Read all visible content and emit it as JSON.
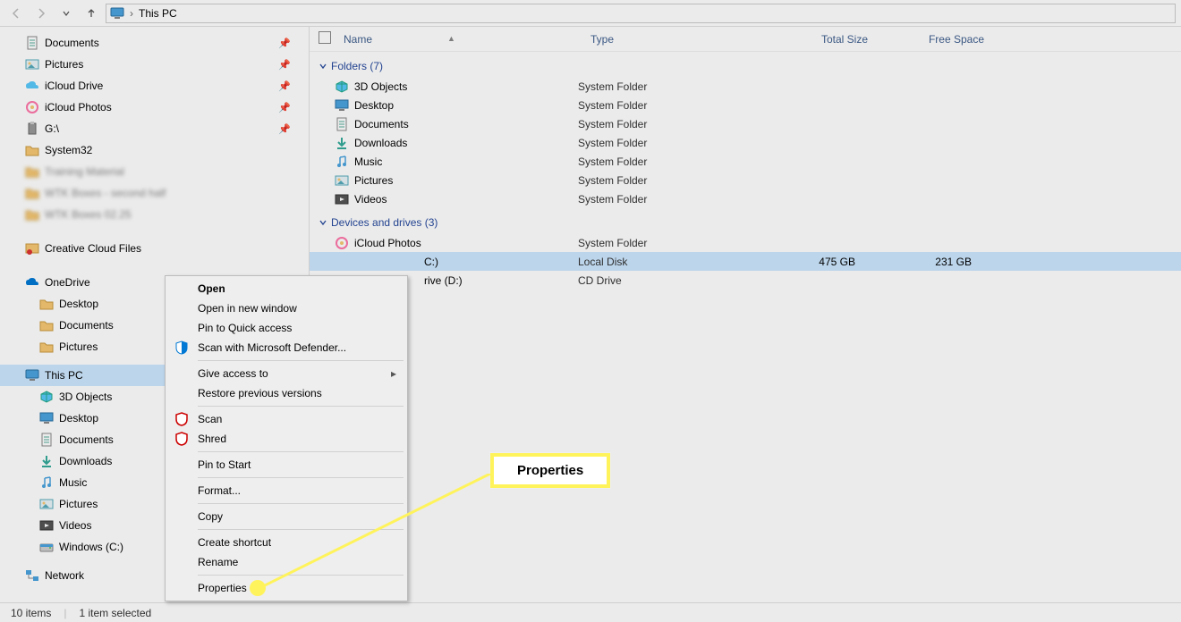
{
  "address": {
    "location": "This PC"
  },
  "sidebar": {
    "quick": [
      {
        "label": "Documents",
        "icon": "doc",
        "pinned": true
      },
      {
        "label": "Pictures",
        "icon": "pic",
        "pinned": true
      },
      {
        "label": "iCloud Drive",
        "icon": "icloud",
        "pinned": true
      },
      {
        "label": "iCloud Photos",
        "icon": "iphotos",
        "pinned": true
      },
      {
        "label": "G:\\",
        "icon": "usb",
        "pinned": true
      },
      {
        "label": "System32",
        "icon": "folder",
        "pinned": false
      },
      {
        "label": "Training Material",
        "icon": "folder",
        "pinned": false,
        "blurred": true
      },
      {
        "label": "WTK Boxes - second half",
        "icon": "folder",
        "pinned": false,
        "blurred": true
      },
      {
        "label": "WTK Boxes 02.25",
        "icon": "folder",
        "pinned": false,
        "blurred": true
      }
    ],
    "creative_label": "Creative Cloud Files",
    "onedrive": {
      "label": "OneDrive",
      "items": [
        {
          "label": "Desktop"
        },
        {
          "label": "Documents"
        },
        {
          "label": "Pictures"
        }
      ]
    },
    "thispc": {
      "label": "This PC",
      "items": [
        {
          "label": "3D Objects",
          "icon": "3d"
        },
        {
          "label": "Desktop",
          "icon": "desktop"
        },
        {
          "label": "Documents",
          "icon": "doc"
        },
        {
          "label": "Downloads",
          "icon": "down"
        },
        {
          "label": "Music",
          "icon": "music"
        },
        {
          "label": "Pictures",
          "icon": "pic"
        },
        {
          "label": "Videos",
          "icon": "video"
        },
        {
          "label": "Windows (C:)",
          "icon": "drive"
        }
      ]
    },
    "network_label": "Network"
  },
  "columns": {
    "name": "Name",
    "type": "Type",
    "total": "Total Size",
    "free": "Free Space"
  },
  "groups": {
    "folders": {
      "header": "Folders (7)",
      "items": [
        {
          "name": "3D Objects",
          "type": "System Folder",
          "icon": "3d"
        },
        {
          "name": "Desktop",
          "type": "System Folder",
          "icon": "desktop"
        },
        {
          "name": "Documents",
          "type": "System Folder",
          "icon": "doc"
        },
        {
          "name": "Downloads",
          "type": "System Folder",
          "icon": "down"
        },
        {
          "name": "Music",
          "type": "System Folder",
          "icon": "music"
        },
        {
          "name": "Pictures",
          "type": "System Folder",
          "icon": "pic"
        },
        {
          "name": "Videos",
          "type": "System Folder",
          "icon": "video"
        }
      ]
    },
    "drives": {
      "header": "Devices and drives (3)",
      "items": [
        {
          "name": "iCloud Photos",
          "type": "System Folder",
          "icon": "iphotos"
        },
        {
          "name": "Windows (C:)",
          "type": "Local Disk",
          "total": "475 GB",
          "free": "231 GB",
          "icon": "drive",
          "selected": true,
          "clipped": "C:)"
        },
        {
          "name": "DVD RW Drive (D:)",
          "type": "CD Drive",
          "icon": "cd",
          "clipped": "rive (D:)"
        }
      ]
    }
  },
  "context_menu": [
    {
      "label": "Open",
      "bold": true
    },
    {
      "label": "Open in new window"
    },
    {
      "label": "Pin to Quick access"
    },
    {
      "label": "Scan with Microsoft Defender...",
      "icon": "defender"
    },
    {
      "sep": true
    },
    {
      "label": "Give access to",
      "submenu": true
    },
    {
      "label": "Restore previous versions"
    },
    {
      "sep": true
    },
    {
      "label": "Scan",
      "icon": "mcafee"
    },
    {
      "label": "Shred",
      "icon": "mcafee"
    },
    {
      "sep": true
    },
    {
      "label": "Pin to Start"
    },
    {
      "sep": true
    },
    {
      "label": "Format..."
    },
    {
      "sep": true
    },
    {
      "label": "Copy"
    },
    {
      "sep": true
    },
    {
      "label": "Create shortcut"
    },
    {
      "label": "Rename"
    },
    {
      "sep": true
    },
    {
      "label": "Properties"
    }
  ],
  "callout_label": "Properties",
  "status": {
    "items": "10 items",
    "selected": "1 item selected"
  }
}
